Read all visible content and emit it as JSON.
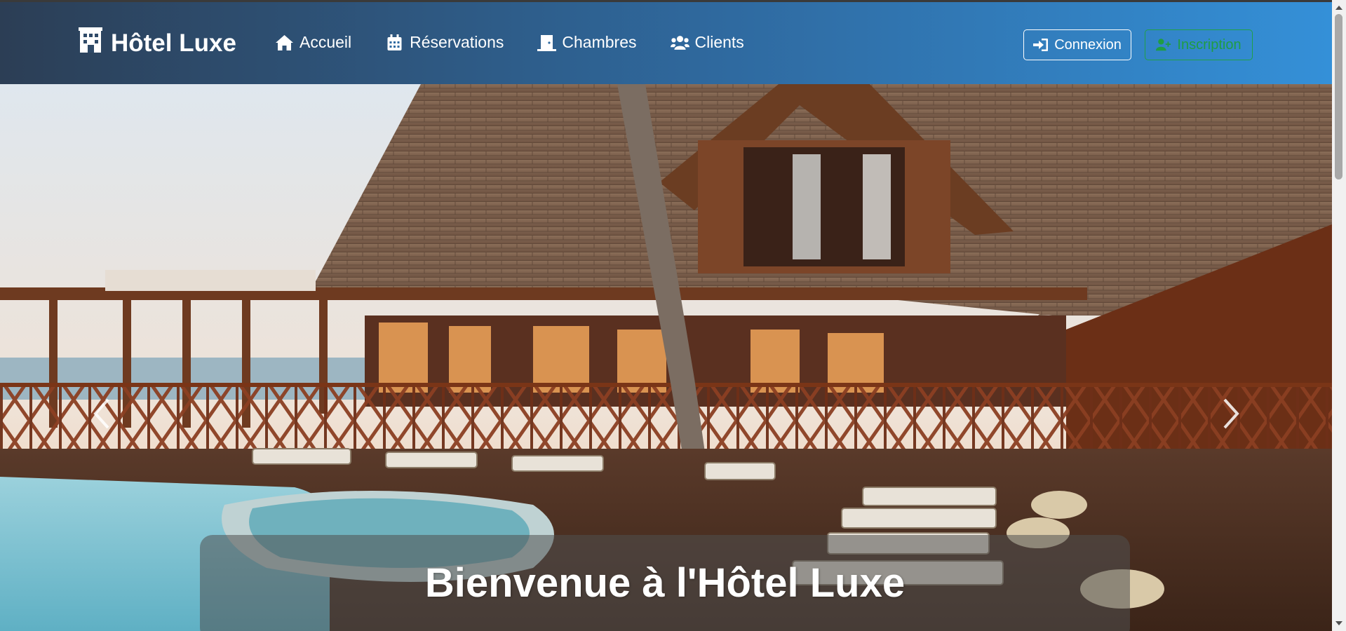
{
  "brand": {
    "name": "Hôtel Luxe",
    "icon": "hotel-building-icon"
  },
  "nav": {
    "items": [
      {
        "label": "Accueil",
        "icon": "home-icon"
      },
      {
        "label": "Réservations",
        "icon": "calendar-icon"
      },
      {
        "label": "Chambres",
        "icon": "door-icon"
      },
      {
        "label": "Clients",
        "icon": "users-icon"
      }
    ]
  },
  "auth": {
    "login_label": "Connexion",
    "login_icon": "sign-in-icon",
    "signup_label": "Inscription",
    "signup_icon": "user-plus-icon"
  },
  "hero": {
    "title": "Bienvenue à l'Hôtel Luxe",
    "controls": {
      "prev_icon": "chevron-left-icon",
      "next_icon": "chevron-right-icon"
    }
  },
  "colors": {
    "nav_gradient_start": "#2c3e55",
    "nav_gradient_end": "#3490d8",
    "signup_green": "#1f9d44"
  }
}
